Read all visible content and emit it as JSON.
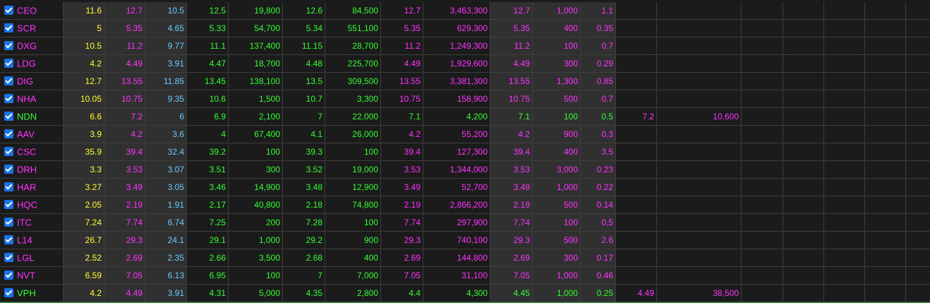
{
  "colors": {
    "ref": "#ffff33",
    "ceiling": "#ff33ff",
    "floor": "#66ccff",
    "up": "#33ff33",
    "bg_dark": "#1b1b1b",
    "bg_shaded": "#303030",
    "grid": "#3e3e3e"
  },
  "columns": [
    {
      "key": "sym",
      "width": 90,
      "shade": false
    },
    {
      "key": "ref",
      "width": 58,
      "shade": true
    },
    {
      "key": "ceiling",
      "width": 58,
      "shade": true
    },
    {
      "key": "floor",
      "width": 59,
      "shade": true
    },
    {
      "key": "bid_price",
      "width": 59,
      "shade": false
    },
    {
      "key": "bid_vol",
      "width": 77,
      "shade": false
    },
    {
      "key": "last_price",
      "width": 60,
      "shade": false
    },
    {
      "key": "last_vol",
      "width": 79,
      "shade": false
    },
    {
      "key": "ask_price",
      "width": 60,
      "shade": false
    },
    {
      "key": "ask_vol",
      "width": 95,
      "shade": false
    },
    {
      "key": "high",
      "width": 60,
      "shade": true
    },
    {
      "key": "lot",
      "width": 68,
      "shade": true
    },
    {
      "key": "change",
      "width": 50,
      "shade": true
    },
    {
      "key": "extra_price",
      "width": 58,
      "shade": false
    },
    {
      "key": "extra_vol",
      "width": 120,
      "shade": false
    },
    {
      "key": "e1",
      "width": 59,
      "shade": false
    },
    {
      "key": "e2",
      "width": 58,
      "shade": false
    },
    {
      "key": "e3",
      "width": 58,
      "shade": false
    },
    {
      "key": "e4",
      "width": 58,
      "shade": false
    },
    {
      "key": "e5",
      "width": 54,
      "shade": false
    }
  ],
  "rows": [
    {
      "symbol": "CEO",
      "sym_color": "ceiling",
      "cells": [
        [
          "11.6",
          "ref"
        ],
        [
          "12.7",
          "ceiling"
        ],
        [
          "10.5",
          "floor"
        ],
        [
          "12.5",
          "up"
        ],
        [
          "19,800",
          "up"
        ],
        [
          "12.6",
          "up"
        ],
        [
          "84,500",
          "up"
        ],
        [
          "12.7",
          "ceiling"
        ],
        [
          "3,463,300",
          "ceiling"
        ],
        [
          "12.7",
          "ceiling"
        ],
        [
          "1,000",
          "ceiling"
        ],
        [
          "1.1",
          "ceiling"
        ],
        [
          "",
          ""
        ],
        [
          "",
          ""
        ]
      ]
    },
    {
      "symbol": "SCR",
      "sym_color": "ceiling",
      "cells": [
        [
          "5",
          "ref"
        ],
        [
          "5.35",
          "ceiling"
        ],
        [
          "4.65",
          "floor"
        ],
        [
          "5.33",
          "up"
        ],
        [
          "54,700",
          "up"
        ],
        [
          "5.34",
          "up"
        ],
        [
          "551,100",
          "up"
        ],
        [
          "5.35",
          "ceiling"
        ],
        [
          "629,300",
          "ceiling"
        ],
        [
          "5.35",
          "ceiling"
        ],
        [
          "400",
          "ceiling"
        ],
        [
          "0.35",
          "ceiling"
        ],
        [
          "",
          ""
        ],
        [
          "",
          ""
        ]
      ]
    },
    {
      "symbol": "DXG",
      "sym_color": "ceiling",
      "cells": [
        [
          "10.5",
          "ref"
        ],
        [
          "11.2",
          "ceiling"
        ],
        [
          "9.77",
          "floor"
        ],
        [
          "11.1",
          "up"
        ],
        [
          "137,400",
          "up"
        ],
        [
          "11.15",
          "up"
        ],
        [
          "28,700",
          "up"
        ],
        [
          "11.2",
          "ceiling"
        ],
        [
          "1,249,300",
          "ceiling"
        ],
        [
          "11.2",
          "ceiling"
        ],
        [
          "100",
          "ceiling"
        ],
        [
          "0.7",
          "ceiling"
        ],
        [
          "",
          ""
        ],
        [
          "",
          ""
        ]
      ]
    },
    {
      "symbol": "LDG",
      "sym_color": "ceiling",
      "cells": [
        [
          "4.2",
          "ref"
        ],
        [
          "4.49",
          "ceiling"
        ],
        [
          "3.91",
          "floor"
        ],
        [
          "4.47",
          "up"
        ],
        [
          "18,700",
          "up"
        ],
        [
          "4.48",
          "up"
        ],
        [
          "225,700",
          "up"
        ],
        [
          "4.49",
          "ceiling"
        ],
        [
          "1,929,600",
          "ceiling"
        ],
        [
          "4.49",
          "ceiling"
        ],
        [
          "300",
          "ceiling"
        ],
        [
          "0.29",
          "ceiling"
        ],
        [
          "",
          ""
        ],
        [
          "",
          ""
        ]
      ]
    },
    {
      "symbol": "DIG",
      "sym_color": "ceiling",
      "cells": [
        [
          "12.7",
          "ref"
        ],
        [
          "13.55",
          "ceiling"
        ],
        [
          "11.85",
          "floor"
        ],
        [
          "13.45",
          "up"
        ],
        [
          "138,100",
          "up"
        ],
        [
          "13.5",
          "up"
        ],
        [
          "309,500",
          "up"
        ],
        [
          "13.55",
          "ceiling"
        ],
        [
          "3,381,300",
          "ceiling"
        ],
        [
          "13.55",
          "ceiling"
        ],
        [
          "1,300",
          "ceiling"
        ],
        [
          "0.85",
          "ceiling"
        ],
        [
          "",
          ""
        ],
        [
          "",
          ""
        ]
      ]
    },
    {
      "symbol": "NHA",
      "sym_color": "ceiling",
      "cells": [
        [
          "10.05",
          "ref"
        ],
        [
          "10.75",
          "ceiling"
        ],
        [
          "9.35",
          "floor"
        ],
        [
          "10.6",
          "up"
        ],
        [
          "1,500",
          "up"
        ],
        [
          "10.7",
          "up"
        ],
        [
          "3,300",
          "up"
        ],
        [
          "10.75",
          "ceiling"
        ],
        [
          "158,900",
          "ceiling"
        ],
        [
          "10.75",
          "ceiling"
        ],
        [
          "500",
          "ceiling"
        ],
        [
          "0.7",
          "ceiling"
        ],
        [
          "",
          ""
        ],
        [
          "",
          ""
        ]
      ]
    },
    {
      "symbol": "NDN",
      "sym_color": "up",
      "cells": [
        [
          "6.6",
          "ref"
        ],
        [
          "7.2",
          "ceiling"
        ],
        [
          "6",
          "floor"
        ],
        [
          "6.9",
          "up"
        ],
        [
          "2,100",
          "up"
        ],
        [
          "7",
          "up"
        ],
        [
          "22,000",
          "up"
        ],
        [
          "7.1",
          "up"
        ],
        [
          "4,200",
          "up"
        ],
        [
          "7.1",
          "up"
        ],
        [
          "100",
          "up"
        ],
        [
          "0.5",
          "up"
        ],
        [
          "7.2",
          "ceiling"
        ],
        [
          "10,600",
          "ceiling"
        ]
      ]
    },
    {
      "symbol": "AAV",
      "sym_color": "ceiling",
      "cells": [
        [
          "3.9",
          "ref"
        ],
        [
          "4.2",
          "ceiling"
        ],
        [
          "3.6",
          "floor"
        ],
        [
          "4",
          "up"
        ],
        [
          "67,400",
          "up"
        ],
        [
          "4.1",
          "up"
        ],
        [
          "26,000",
          "up"
        ],
        [
          "4.2",
          "ceiling"
        ],
        [
          "55,200",
          "ceiling"
        ],
        [
          "4.2",
          "ceiling"
        ],
        [
          "900",
          "ceiling"
        ],
        [
          "0.3",
          "ceiling"
        ],
        [
          "",
          ""
        ],
        [
          "",
          ""
        ]
      ]
    },
    {
      "symbol": "CSC",
      "sym_color": "ceiling",
      "cells": [
        [
          "35.9",
          "ref"
        ],
        [
          "39.4",
          "ceiling"
        ],
        [
          "32.4",
          "floor"
        ],
        [
          "39.2",
          "up"
        ],
        [
          "100",
          "up"
        ],
        [
          "39.3",
          "up"
        ],
        [
          "100",
          "up"
        ],
        [
          "39.4",
          "ceiling"
        ],
        [
          "127,300",
          "ceiling"
        ],
        [
          "39.4",
          "ceiling"
        ],
        [
          "400",
          "ceiling"
        ],
        [
          "3.5",
          "ceiling"
        ],
        [
          "",
          ""
        ],
        [
          "",
          ""
        ]
      ]
    },
    {
      "symbol": "DRH",
      "sym_color": "ceiling",
      "cells": [
        [
          "3.3",
          "ref"
        ],
        [
          "3.53",
          "ceiling"
        ],
        [
          "3.07",
          "floor"
        ],
        [
          "3.51",
          "up"
        ],
        [
          "300",
          "up"
        ],
        [
          "3.52",
          "up"
        ],
        [
          "19,000",
          "up"
        ],
        [
          "3.53",
          "ceiling"
        ],
        [
          "1,344,000",
          "ceiling"
        ],
        [
          "3.53",
          "ceiling"
        ],
        [
          "3,000",
          "ceiling"
        ],
        [
          "0.23",
          "ceiling"
        ],
        [
          "",
          ""
        ],
        [
          "",
          ""
        ]
      ]
    },
    {
      "symbol": "HAR",
      "sym_color": "ceiling",
      "cells": [
        [
          "3.27",
          "ref"
        ],
        [
          "3.49",
          "ceiling"
        ],
        [
          "3.05",
          "floor"
        ],
        [
          "3.46",
          "up"
        ],
        [
          "14,900",
          "up"
        ],
        [
          "3.48",
          "up"
        ],
        [
          "12,900",
          "up"
        ],
        [
          "3.49",
          "ceiling"
        ],
        [
          "52,700",
          "ceiling"
        ],
        [
          "3.49",
          "ceiling"
        ],
        [
          "1,000",
          "ceiling"
        ],
        [
          "0.22",
          "ceiling"
        ],
        [
          "",
          ""
        ],
        [
          "",
          ""
        ]
      ]
    },
    {
      "symbol": "HQC",
      "sym_color": "ceiling",
      "cells": [
        [
          "2.05",
          "ref"
        ],
        [
          "2.19",
          "ceiling"
        ],
        [
          "1.91",
          "floor"
        ],
        [
          "2.17",
          "up"
        ],
        [
          "40,800",
          "up"
        ],
        [
          "2.18",
          "up"
        ],
        [
          "74,800",
          "up"
        ],
        [
          "2.19",
          "ceiling"
        ],
        [
          "2,866,200",
          "ceiling"
        ],
        [
          "2.19",
          "ceiling"
        ],
        [
          "500",
          "ceiling"
        ],
        [
          "0.14",
          "ceiling"
        ],
        [
          "",
          ""
        ],
        [
          "",
          ""
        ]
      ]
    },
    {
      "symbol": "ITC",
      "sym_color": "ceiling",
      "cells": [
        [
          "7.24",
          "ref"
        ],
        [
          "7.74",
          "ceiling"
        ],
        [
          "6.74",
          "floor"
        ],
        [
          "7.25",
          "up"
        ],
        [
          "200",
          "up"
        ],
        [
          "7.28",
          "up"
        ],
        [
          "100",
          "up"
        ],
        [
          "7.74",
          "ceiling"
        ],
        [
          "297,900",
          "ceiling"
        ],
        [
          "7.74",
          "ceiling"
        ],
        [
          "100",
          "ceiling"
        ],
        [
          "0.5",
          "ceiling"
        ],
        [
          "",
          ""
        ],
        [
          "",
          ""
        ]
      ]
    },
    {
      "symbol": "L14",
      "sym_color": "ceiling",
      "cells": [
        [
          "26.7",
          "ref"
        ],
        [
          "29.3",
          "ceiling"
        ],
        [
          "24.1",
          "floor"
        ],
        [
          "29.1",
          "up"
        ],
        [
          "1,000",
          "up"
        ],
        [
          "29.2",
          "up"
        ],
        [
          "900",
          "up"
        ],
        [
          "29.3",
          "ceiling"
        ],
        [
          "740,100",
          "ceiling"
        ],
        [
          "29.3",
          "ceiling"
        ],
        [
          "500",
          "ceiling"
        ],
        [
          "2.6",
          "ceiling"
        ],
        [
          "",
          ""
        ],
        [
          "",
          ""
        ]
      ]
    },
    {
      "symbol": "LGL",
      "sym_color": "ceiling",
      "cells": [
        [
          "2.52",
          "ref"
        ],
        [
          "2.69",
          "ceiling"
        ],
        [
          "2.35",
          "floor"
        ],
        [
          "2.66",
          "up"
        ],
        [
          "3,500",
          "up"
        ],
        [
          "2.68",
          "up"
        ],
        [
          "400",
          "up"
        ],
        [
          "2.69",
          "ceiling"
        ],
        [
          "144,800",
          "ceiling"
        ],
        [
          "2.69",
          "ceiling"
        ],
        [
          "300",
          "ceiling"
        ],
        [
          "0.17",
          "ceiling"
        ],
        [
          "",
          ""
        ],
        [
          "",
          ""
        ]
      ]
    },
    {
      "symbol": "NVT",
      "sym_color": "ceiling",
      "cells": [
        [
          "6.59",
          "ref"
        ],
        [
          "7.05",
          "ceiling"
        ],
        [
          "6.13",
          "floor"
        ],
        [
          "6.95",
          "up"
        ],
        [
          "100",
          "up"
        ],
        [
          "7",
          "up"
        ],
        [
          "7,000",
          "up"
        ],
        [
          "7.05",
          "ceiling"
        ],
        [
          "31,100",
          "ceiling"
        ],
        [
          "7.05",
          "ceiling"
        ],
        [
          "1,000",
          "ceiling"
        ],
        [
          "0.46",
          "ceiling"
        ],
        [
          "",
          ""
        ],
        [
          "",
          ""
        ]
      ]
    },
    {
      "symbol": "VPH",
      "sym_color": "up",
      "cells": [
        [
          "4.2",
          "ref"
        ],
        [
          "4.49",
          "ceiling"
        ],
        [
          "3.91",
          "floor"
        ],
        [
          "4.31",
          "up"
        ],
        [
          "5,000",
          "up"
        ],
        [
          "4.35",
          "up"
        ],
        [
          "2,800",
          "up"
        ],
        [
          "4.4",
          "up"
        ],
        [
          "4,300",
          "up"
        ],
        [
          "4.45",
          "up"
        ],
        [
          "1,000",
          "up"
        ],
        [
          "0.25",
          "up"
        ],
        [
          "4.49",
          "ceiling"
        ],
        [
          "38,500",
          "ceiling"
        ]
      ]
    }
  ]
}
